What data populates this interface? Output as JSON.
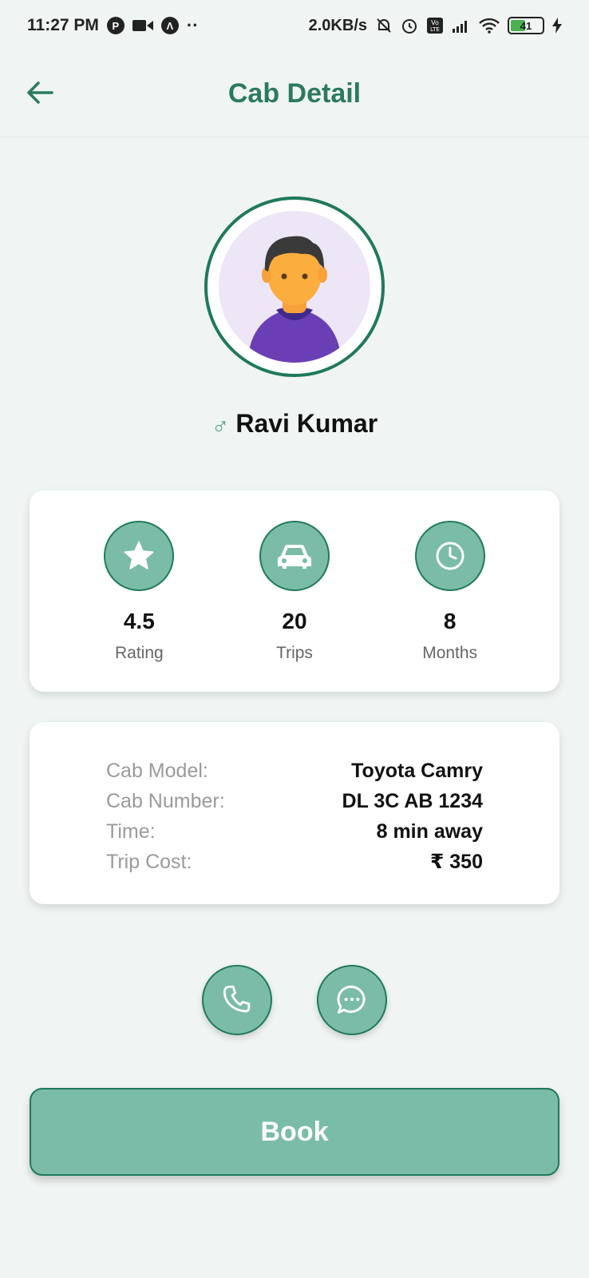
{
  "status_bar": {
    "time": "11:27 PM",
    "speed": "2.0KB/s",
    "battery": "41"
  },
  "header": {
    "title": "Cab Detail"
  },
  "driver": {
    "gender_symbol": "♂",
    "name": "Ravi Kumar"
  },
  "stats": [
    {
      "icon": "star-icon",
      "value": "4.5",
      "label": "Rating"
    },
    {
      "icon": "car-icon",
      "value": "20",
      "label": "Trips"
    },
    {
      "icon": "clock-icon",
      "value": "8",
      "label": "Months"
    }
  ],
  "details": [
    {
      "label": "Cab Model:",
      "value": "Toyota Camry"
    },
    {
      "label": "Cab Number:",
      "value": "DL 3C AB 1234"
    },
    {
      "label": "Time:",
      "value": "8 min away"
    },
    {
      "label": "Trip Cost:",
      "value": "₹ 350"
    }
  ],
  "actions": {
    "call_icon": "phone-icon",
    "message_icon": "message-icon"
  },
  "book": {
    "label": "Book"
  },
  "colors": {
    "accent": "#2b7a60",
    "button_fill": "#7bbca9",
    "button_border": "#1f7a5a",
    "background": "#f0f4f3"
  }
}
